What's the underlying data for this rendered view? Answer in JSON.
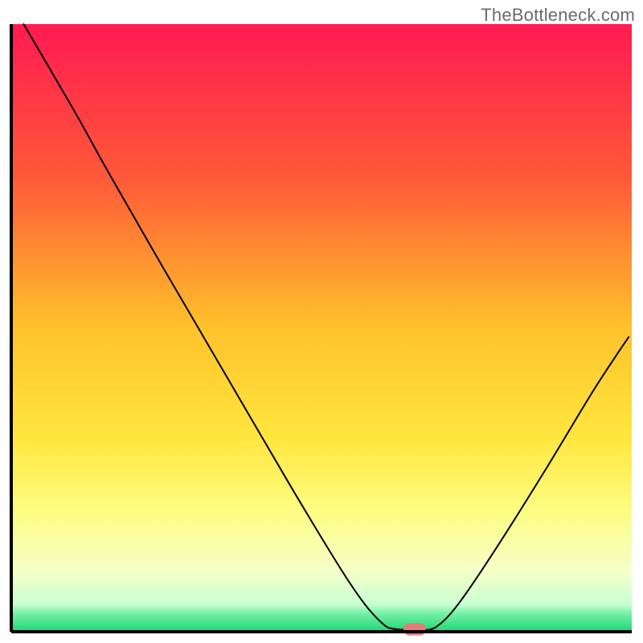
{
  "watermark": "TheBottleneck.com",
  "chart_data": {
    "type": "line",
    "title": "",
    "xlabel": "",
    "ylabel": "",
    "xlim": [
      0,
      100
    ],
    "ylim": [
      0,
      100
    ],
    "grid": false,
    "axes_visible": {
      "left": true,
      "bottom": true,
      "right": false,
      "top": false
    },
    "background": {
      "type": "vertical-gradient",
      "stops": [
        {
          "pos": 0,
          "color": "#ff1a52"
        },
        {
          "pos": 25,
          "color": "#ff5838"
        },
        {
          "pos": 50,
          "color": "#ffc22b"
        },
        {
          "pos": 68,
          "color": "#ffe63e"
        },
        {
          "pos": 80,
          "color": "#fdfc82"
        },
        {
          "pos": 90,
          "color": "#f6ffc8"
        },
        {
          "pos": 95.5,
          "color": "#c8ffd2"
        },
        {
          "pos": 97,
          "color": "#74f0a6"
        },
        {
          "pos": 100,
          "color": "#1cd775"
        }
      ]
    },
    "series": [
      {
        "name": "curve",
        "color": "#000000",
        "width": 2,
        "x": [
          2.0,
          10.0,
          13.0,
          16.0,
          25.0,
          35.0,
          45.0,
          53.0,
          57.0,
          60.0,
          61.5,
          64.0,
          66.0,
          68.5,
          72.0,
          78.0,
          86.0,
          94.0,
          99.5
        ],
        "y": [
          100.0,
          86.0,
          80.5,
          75.0,
          59.0,
          41.5,
          24.0,
          10.5,
          4.5,
          1.2,
          0.5,
          0.3,
          0.3,
          0.8,
          4.5,
          13.5,
          26.5,
          40.0,
          48.5
        ]
      }
    ],
    "markers": [
      {
        "name": "highlight-marker",
        "shape": "rounded-rect",
        "center_x": 65.0,
        "center_y": 0.4,
        "width": 3.6,
        "height": 2.0,
        "color": "#e77a77"
      }
    ]
  }
}
